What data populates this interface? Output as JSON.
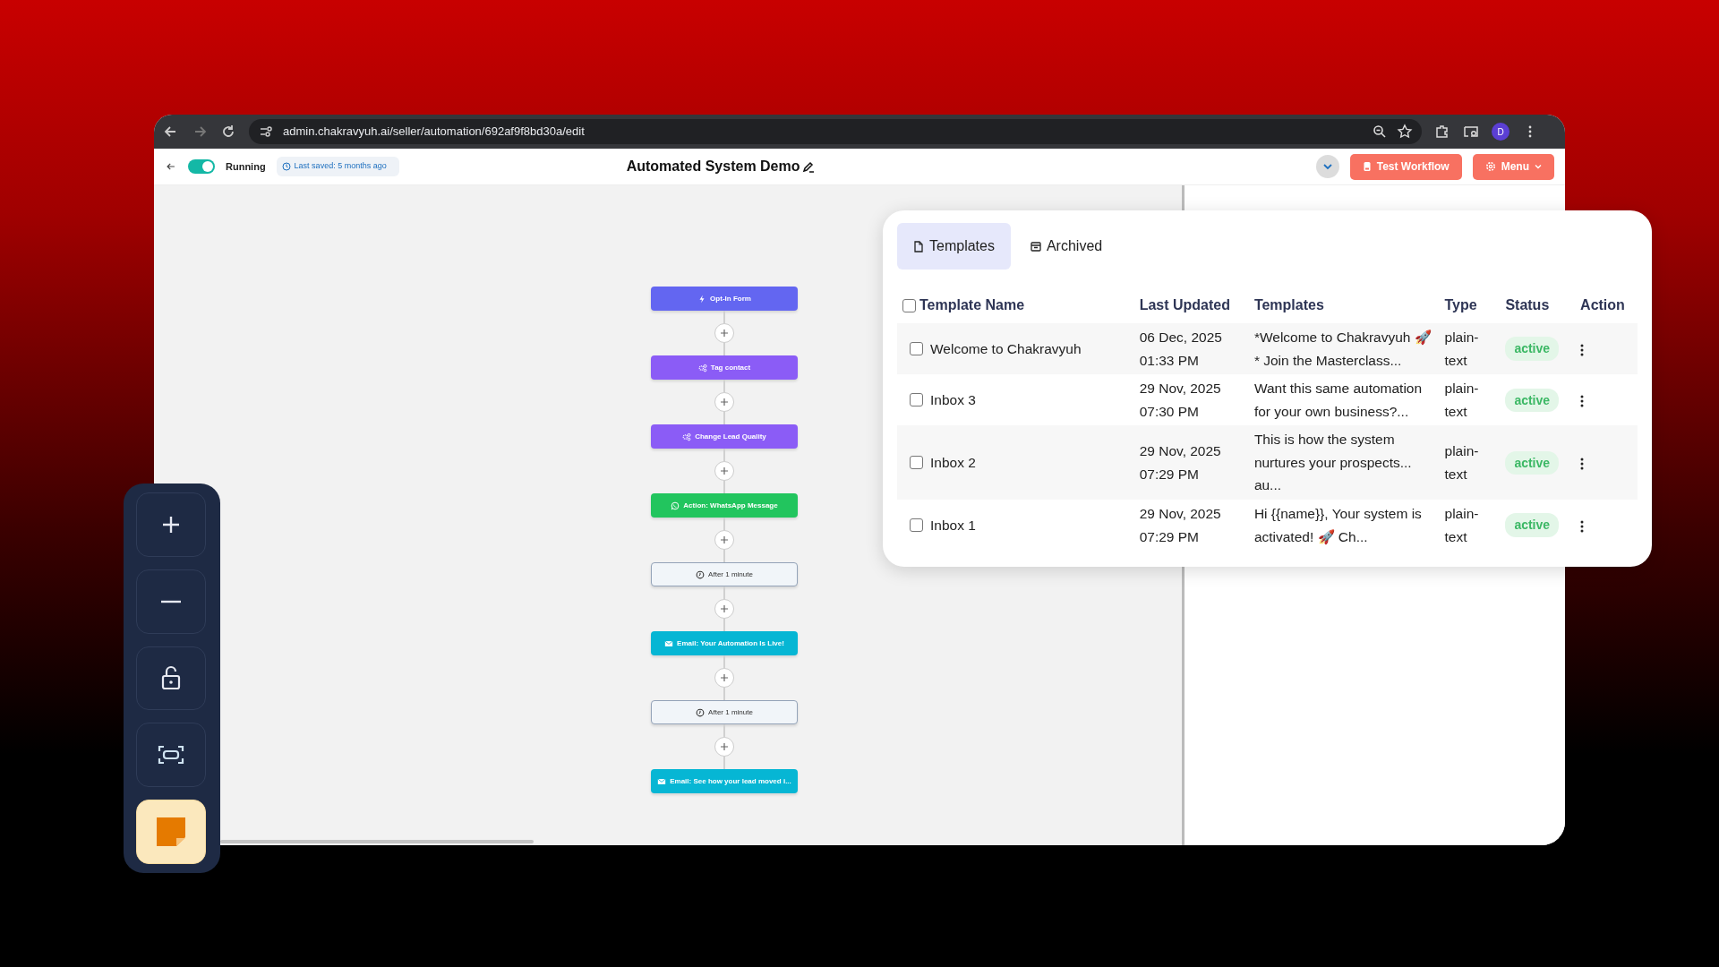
{
  "browser": {
    "url": "admin.chakravyuh.ai/seller/automation/692af9f8bd30a/edit",
    "profile_initial": "D"
  },
  "header": {
    "running": true,
    "status_label": "Running",
    "last_saved": "Last saved: 5 months ago",
    "title": "Automated System Demo",
    "test_button": "Test Workflow",
    "menu_button": "Menu"
  },
  "flow": {
    "nodes": [
      {
        "label": "Opt-In Form",
        "kind": "trigger"
      },
      {
        "label": "Tag contact",
        "kind": "tag"
      },
      {
        "label": "Change Lead Quality",
        "kind": "tag"
      },
      {
        "label": "Action: WhatsApp Message",
        "kind": "whatsapp"
      },
      {
        "label": "After 1 minute",
        "kind": "delay"
      },
      {
        "label": "Email: Your Automation Is Live!",
        "kind": "email"
      },
      {
        "label": "After 1 minute",
        "kind": "delay"
      },
      {
        "label": "Email: See how your lead moved i...",
        "kind": "email"
      }
    ]
  },
  "templates_panel": {
    "tabs": [
      {
        "label": "Templates",
        "selected": true
      },
      {
        "label": "Archived",
        "selected": false
      }
    ],
    "select_all_checked": false,
    "columns": [
      "Template Name",
      "Last Updated",
      "Templates",
      "Type",
      "Status",
      "Action"
    ],
    "rows": [
      {
        "name": "Welcome to Chakravyuh",
        "checked": false,
        "last_updated": "06 Dec, 2025 01:33 PM",
        "preview": "*Welcome to Chakravyuh 🚀* Join the Masterclass...",
        "type": "plain-text",
        "status": "active"
      },
      {
        "name": "Inbox 3",
        "checked": false,
        "last_updated": "29 Nov, 2025 07:30 PM",
        "preview": "Want this same automation for your own business?...",
        "type": "plain-text",
        "status": "active"
      },
      {
        "name": "Inbox 2",
        "checked": false,
        "last_updated": "29 Nov, 2025 07:29 PM",
        "preview": "This is how the system nurtures your prospects... au...",
        "type": "plain-text",
        "status": "active"
      },
      {
        "name": "Inbox 1",
        "checked": false,
        "last_updated": "29 Nov, 2025 07:29 PM",
        "preview": "Hi {{name}}, Your system is activated! 🚀 Ch...",
        "type": "plain-text",
        "status": "active"
      }
    ]
  }
}
